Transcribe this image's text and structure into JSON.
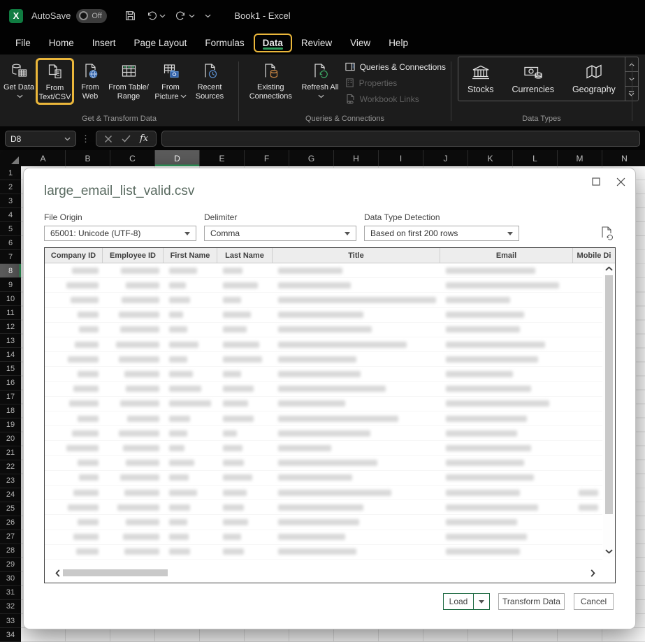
{
  "titlebar": {
    "autosave_label": "AutoSave",
    "autosave_state": "Off",
    "workbook_title": "Book1 - Excel"
  },
  "menubar": {
    "tabs": [
      "File",
      "Home",
      "Insert",
      "Page Layout",
      "Formulas",
      "Data",
      "Review",
      "View",
      "Help"
    ],
    "active_tab": "Data"
  },
  "ribbon": {
    "groups": [
      {
        "label": "Get & Transform Data",
        "buttons": [
          {
            "label": "Get Data",
            "icon": "database-table",
            "chevron": true
          },
          {
            "label": "From Text/CSV",
            "icon": "doc-pages",
            "highlighted": true
          },
          {
            "label": "From Web",
            "icon": "doc-globe"
          },
          {
            "label": "From Table/ Range",
            "icon": "table-grid"
          },
          {
            "label": "From Picture",
            "icon": "grid-camera",
            "chevron": true
          },
          {
            "label": "Recent Sources",
            "icon": "doc-clock"
          }
        ]
      },
      {
        "label": "Queries & Connections",
        "buttons": [
          {
            "label": "Existing Connections",
            "icon": "doc-cylinder"
          },
          {
            "label": "Refresh All",
            "icon": "doc-refresh",
            "chevron": true
          }
        ],
        "stack": [
          {
            "label": "Queries & Connections",
            "icon": "window-pane",
            "enabled": true
          },
          {
            "label": "Properties",
            "icon": "properties",
            "enabled": false
          },
          {
            "label": "Workbook Links",
            "icon": "doc-link",
            "enabled": false
          }
        ]
      },
      {
        "label": "Data Types",
        "gallery": [
          {
            "label": "Stocks",
            "icon": "bank"
          },
          {
            "label": "Currencies",
            "icon": "banknote-coins"
          },
          {
            "label": "Geography",
            "icon": "folded-map"
          }
        ]
      }
    ]
  },
  "formula_bar": {
    "name_box_value": "D8"
  },
  "sheet": {
    "columns": [
      "A",
      "B",
      "C",
      "D",
      "E",
      "F",
      "G",
      "H",
      "I",
      "J",
      "K",
      "L",
      "M",
      "N"
    ],
    "selected_column": "D",
    "rows": [
      "1",
      "2",
      "3",
      "4",
      "5",
      "6",
      "7",
      "8",
      "9",
      "10",
      "11",
      "12",
      "13",
      "14",
      "15",
      "16",
      "17",
      "18",
      "19",
      "20",
      "21",
      "22",
      "23",
      "24",
      "25",
      "26",
      "27",
      "28",
      "29",
      "30",
      "31",
      "32",
      "33",
      "34"
    ],
    "selected_row": "8"
  },
  "dialog": {
    "title": "large_email_list_valid.csv",
    "fields": [
      {
        "label": "File Origin",
        "value": "65001: Unicode (UTF-8)"
      },
      {
        "label": "Delimiter",
        "value": "Comma"
      },
      {
        "label": "Data Type Detection",
        "value": "Based on first 200 rows"
      }
    ],
    "preview": {
      "columns": [
        "Company ID",
        "Employee ID",
        "First Name",
        "Last Name",
        "Title",
        "Email",
        "Mobile Di"
      ],
      "redacted": true,
      "redacted_rows": [
        [
          38,
          55,
          40,
          28,
          92,
          128,
          0
        ],
        [
          46,
          48,
          24,
          50,
          104,
          162,
          0
        ],
        [
          40,
          54,
          30,
          26,
          230,
          92,
          0
        ],
        [
          30,
          58,
          20,
          40,
          122,
          112,
          0
        ],
        [
          28,
          56,
          26,
          34,
          134,
          106,
          0
        ],
        [
          34,
          62,
          42,
          52,
          184,
          142,
          0
        ],
        [
          44,
          58,
          26,
          56,
          112,
          132,
          0
        ],
        [
          30,
          50,
          34,
          26,
          118,
          96,
          0
        ],
        [
          36,
          48,
          46,
          44,
          154,
          122,
          0
        ],
        [
          42,
          56,
          60,
          36,
          96,
          148,
          0
        ],
        [
          30,
          46,
          30,
          44,
          172,
          116,
          0
        ],
        [
          38,
          58,
          26,
          20,
          132,
          102,
          0
        ],
        [
          46,
          52,
          22,
          28,
          76,
          122,
          0
        ],
        [
          30,
          48,
          36,
          30,
          142,
          112,
          0
        ],
        [
          28,
          56,
          28,
          42,
          106,
          126,
          0
        ],
        [
          36,
          50,
          40,
          34,
          162,
          106,
          36
        ],
        [
          44,
          60,
          30,
          30,
          122,
          132,
          42
        ],
        [
          30,
          48,
          26,
          36,
          116,
          102,
          0
        ],
        [
          36,
          52,
          28,
          26,
          96,
          116,
          0
        ],
        [
          32,
          50,
          30,
          30,
          112,
          106,
          0
        ]
      ]
    },
    "buttons": {
      "load": "Load",
      "transform": "Transform Data",
      "cancel": "Cancel"
    }
  }
}
